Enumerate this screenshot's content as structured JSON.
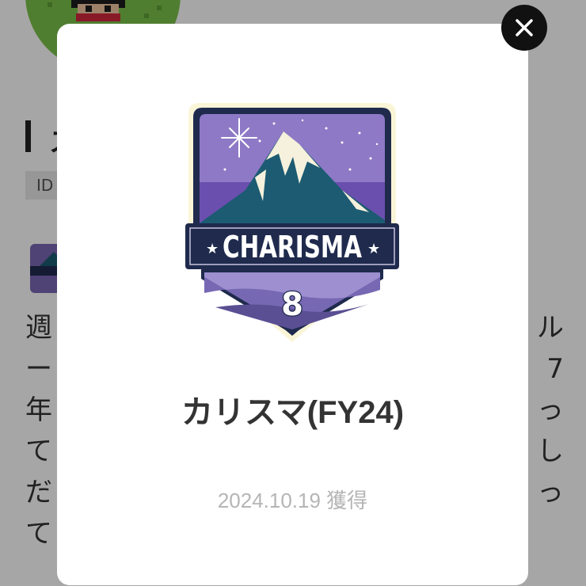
{
  "background": {
    "id_label": "ID",
    "description_lines": [
      {
        "left": "週",
        "right": "ル"
      },
      {
        "left": "ー",
        "right": "7"
      },
      {
        "left": "年",
        "right": "っ"
      },
      {
        "left": "て",
        "right": "し"
      },
      {
        "left": "だ",
        "right": "っ"
      },
      {
        "left": "て",
        "right": ""
      }
    ]
  },
  "modal": {
    "badge": {
      "banner_text": "CHARISMA",
      "level": "8"
    },
    "title": "カリスマ(FY24)",
    "acquired_date": "2024.10.19 獲得"
  },
  "icons": {
    "close": "close-icon",
    "badge": "charisma-badge-icon",
    "avatar": "pixel-avatar"
  },
  "colors": {
    "overlay": "rgba(0,0,0,0.35)",
    "close_button": "#111111",
    "badge_purple": "#7a66b3",
    "badge_navy": "#1f2a4d",
    "badge_mountain": "#1c5b72",
    "title_text": "#333333",
    "date_text": "#b5b5b5"
  }
}
